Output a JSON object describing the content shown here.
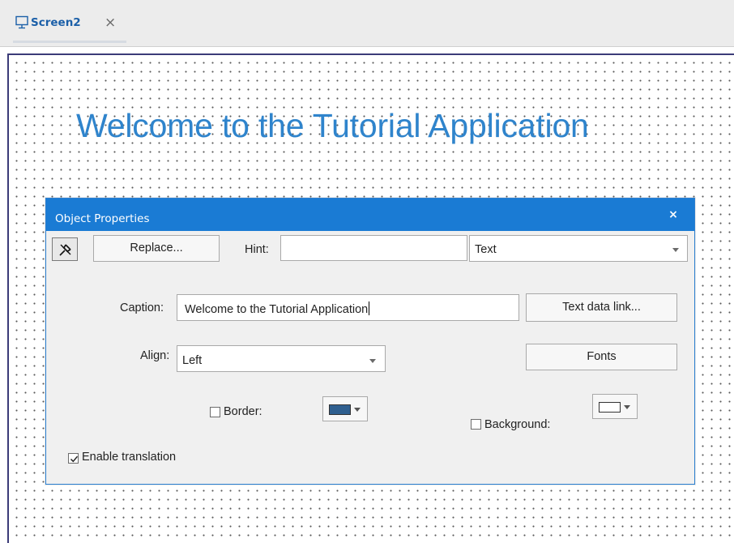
{
  "tab": {
    "label": "Screen2",
    "close": "×",
    "icon": "monitor-icon"
  },
  "canvas": {
    "label_text": "Welcome to the Tutorial Application",
    "label_color": "#2f84cc"
  },
  "dialog": {
    "title": "Object Properties",
    "close": "×",
    "pin_icon": "pin-icon",
    "replace_label": "Replace...",
    "hint_label": "Hint:",
    "hint_value": "",
    "type_value": "Text",
    "caption_label": "Caption:",
    "caption_value": "Welcome to the Tutorial Application",
    "text_data_link_label": "Text data link...",
    "align_label": "Align:",
    "align_value": "Left",
    "fonts_label": "Fonts",
    "border_label": "Border:",
    "border_checked": false,
    "border_color": "#2f5f8f",
    "background_label": "Background:",
    "background_checked": false,
    "background_color": "#ffffff",
    "enable_translation_label": "Enable translation",
    "enable_translation_checked": true,
    "accent_color": "#1a7bd4"
  }
}
